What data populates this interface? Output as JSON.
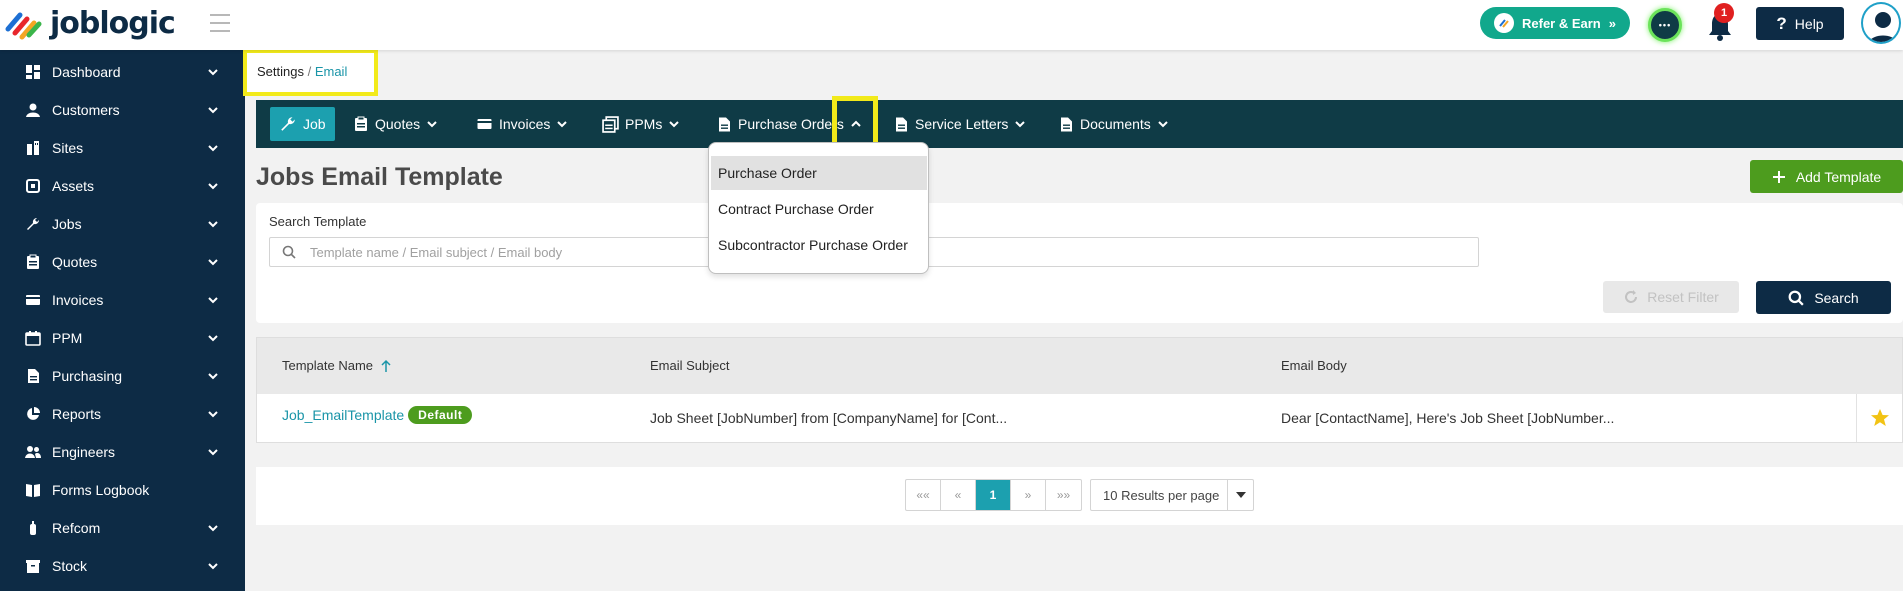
{
  "app": {
    "name": "joblogic"
  },
  "topbar": {
    "refer_label": "Refer & Earn",
    "refer_arrows": "»",
    "chat_glyph": "•••",
    "notification_count": "1",
    "help_label": "Help",
    "help_glyph": "?"
  },
  "sidebar": {
    "items": [
      {
        "label": "Dashboard",
        "icon": "dashboard-icon",
        "has_chevron": true
      },
      {
        "label": "Customers",
        "icon": "person-icon",
        "has_chevron": true
      },
      {
        "label": "Sites",
        "icon": "building-icon",
        "has_chevron": true
      },
      {
        "label": "Assets",
        "icon": "asset-icon",
        "has_chevron": true
      },
      {
        "label": "Jobs",
        "icon": "wrench-icon",
        "has_chevron": true
      },
      {
        "label": "Quotes",
        "icon": "clipboard-icon",
        "has_chevron": true
      },
      {
        "label": "Invoices",
        "icon": "card-icon",
        "has_chevron": true
      },
      {
        "label": "PPM",
        "icon": "calendar-icon",
        "has_chevron": true
      },
      {
        "label": "Purchasing",
        "icon": "document-icon",
        "has_chevron": true
      },
      {
        "label": "Reports",
        "icon": "pie-chart-icon",
        "has_chevron": true
      },
      {
        "label": "Engineers",
        "icon": "people-icon",
        "has_chevron": true
      },
      {
        "label": "Forms Logbook",
        "icon": "book-icon",
        "has_chevron": false
      },
      {
        "label": "Refcom",
        "icon": "cylinder-icon",
        "has_chevron": true
      },
      {
        "label": "Stock",
        "icon": "box-icon",
        "has_chevron": true
      }
    ]
  },
  "breadcrumb": {
    "root": "Settings",
    "separator": " / ",
    "current": "Email"
  },
  "tabs": [
    {
      "label": "Job",
      "icon": "wrench-icon",
      "active": true
    },
    {
      "label": "Quotes",
      "icon": "clipboard-icon",
      "active": false
    },
    {
      "label": "Invoices",
      "icon": "card-icon",
      "active": false
    },
    {
      "label": "PPMs",
      "icon": "stack-icon",
      "active": false
    },
    {
      "label": "Purchase Orders",
      "icon": "document-icon",
      "active": false,
      "expanded": true
    },
    {
      "label": "Service Letters",
      "icon": "document-icon",
      "active": false
    },
    {
      "label": "Documents",
      "icon": "document-icon",
      "active": false
    }
  ],
  "dropdown": {
    "items": [
      {
        "label": "Purchase Order",
        "hovered": true
      },
      {
        "label": "Contract Purchase Order"
      },
      {
        "label": "Subcontractor Purchase Order"
      }
    ]
  },
  "main": {
    "title": "Jobs Email Template",
    "add_label": "Add Template",
    "search_label": "Search Template",
    "search_placeholder": "Template name / Email subject / Email body",
    "reset_label": "Reset Filter",
    "search_button": "Search"
  },
  "table": {
    "columns": [
      "Template Name",
      "Email Subject",
      "Email Body"
    ],
    "sort_column": "Template Name",
    "sort_direction": "ascending",
    "rows": [
      {
        "name": "Job_EmailTemplate",
        "badge": "Default",
        "subject": "Job Sheet [JobNumber] from [CompanyName] for [Cont...",
        "body": "Dear [ContactName], Here's Job Sheet [JobNumber...",
        "starred": true
      }
    ]
  },
  "pagination": {
    "first": "««",
    "prev": "«",
    "current": "1",
    "next": "»",
    "last": "»»",
    "per_page": "10 Results per page"
  },
  "colors": {
    "sidebar_bg": "#0d2b45",
    "tabbar_bg": "#0f3b46",
    "accent_teal": "#1ca0af",
    "accent_green": "#4d9c1e",
    "refer_green": "#11a88c",
    "highlight_yellow": "#f2ea1a",
    "star_gold": "#f2c314"
  }
}
